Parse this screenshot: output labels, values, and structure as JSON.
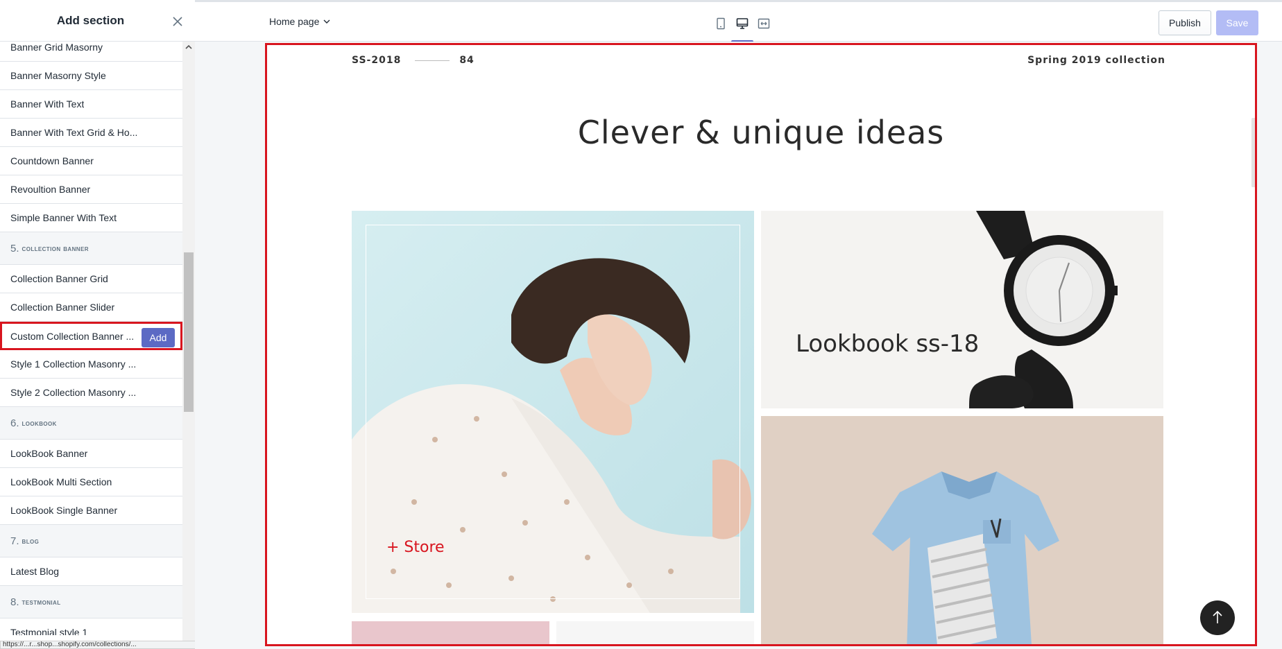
{
  "sidebar": {
    "title": "Add section",
    "entries": [
      {
        "kind": "item",
        "label": "Banner Grid Masorny"
      },
      {
        "kind": "item",
        "label": "Banner Masorny Style"
      },
      {
        "kind": "item",
        "label": "Banner With Text"
      },
      {
        "kind": "item",
        "label": "Banner With Text Grid & Ho..."
      },
      {
        "kind": "item",
        "label": "Countdown Banner"
      },
      {
        "kind": "item",
        "label": "Revoultion Banner"
      },
      {
        "kind": "item",
        "label": "Simple Banner With Text"
      },
      {
        "kind": "header",
        "num": "5.",
        "label": "COLLECTION BANNER"
      },
      {
        "kind": "item",
        "label": "Collection Banner Grid"
      },
      {
        "kind": "item",
        "label": "Collection Banner Slider"
      },
      {
        "kind": "item",
        "label": "Custom Collection Banner ...",
        "active": true
      },
      {
        "kind": "item",
        "label": "Style 1 Collection Masonry ..."
      },
      {
        "kind": "item",
        "label": "Style 2 Collection Masonry ..."
      },
      {
        "kind": "header",
        "num": "6.",
        "label": "LOOKBOOK"
      },
      {
        "kind": "item",
        "label": "LookBook Banner"
      },
      {
        "kind": "item",
        "label": "LookBook Multi Section"
      },
      {
        "kind": "item",
        "label": "LookBook Single Banner"
      },
      {
        "kind": "header",
        "num": "7.",
        "label": "BLOG"
      },
      {
        "kind": "item",
        "label": "Latest Blog"
      },
      {
        "kind": "header",
        "num": "8.",
        "label": "TESTMONIAL"
      },
      {
        "kind": "item",
        "label": "Testmonial style 1"
      }
    ],
    "add_label": "Add",
    "status_url": "https://...r...shop...shopify.com/collections/..."
  },
  "topbar": {
    "page_selector": "Home page",
    "publish_label": "Publish",
    "save_label": "Save",
    "accent_color": "#5c6ac4"
  },
  "preview": {
    "season_code": "SS-2018",
    "season_number": "84",
    "collection_label": "Spring 2019 collection",
    "heading": "Clever & unique ideas",
    "store_link": "+ Store",
    "lookbook_text": "Lookbook ss-18",
    "frame_color": "#d8151f"
  }
}
